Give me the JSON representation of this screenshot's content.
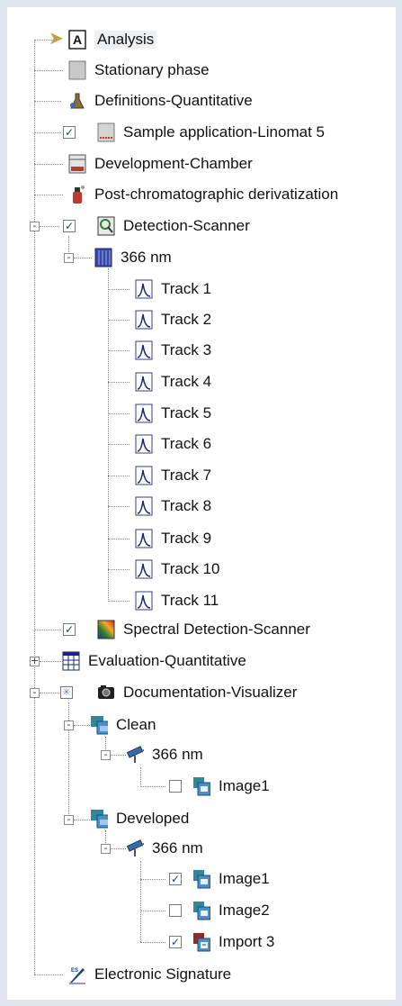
{
  "tree": {
    "analysis": "Analysis",
    "stationary_phase": "Stationary phase",
    "definitions_quantitative": "Definitions-Quantitative",
    "sample_application": "Sample application-Linomat 5",
    "development_chamber": "Development-Chamber",
    "post_chromatographic": "Post-chromatographic derivatization",
    "detection_scanner": "Detection-Scanner",
    "wavelength_366": "366 nm",
    "tracks": [
      "Track 1",
      "Track 2",
      "Track 3",
      "Track 4",
      "Track 5",
      "Track 6",
      "Track 7",
      "Track 8",
      "Track 9",
      "Track 10",
      "Track 11"
    ],
    "spectral_detection": "Spectral Detection-Scanner",
    "evaluation_quantitative": "Evaluation-Quantitative",
    "documentation_visualizer": "Documentation-Visualizer",
    "clean": "Clean",
    "clean_366": "366 nm",
    "clean_image1": "Image1",
    "developed": "Developed",
    "developed_366": "366 nm",
    "developed_image1": "Image1",
    "developed_image2": "Image2",
    "developed_import3": "Import 3",
    "electronic_signature": "Electronic Signature"
  },
  "checkboxes": {
    "sample_application": true,
    "detection_scanner": true,
    "spectral_detection": true,
    "clean_image1": false,
    "developed_image1": true,
    "developed_image2": false,
    "developed_import3": true
  },
  "expanders": {
    "detection_scanner": "-",
    "wavelength_366": "-",
    "evaluation_quantitative": "+",
    "documentation_visualizer": "-",
    "clean": "-",
    "clean_366": "-",
    "developed": "-",
    "developed_366": "-"
  },
  "icons": {
    "analysis": "analysis-icon",
    "stationary_phase": "plate-icon",
    "definitions_quantitative": "flask-icon",
    "sample_application": "sample-application-icon",
    "development_chamber": "chamber-icon",
    "post_chromatographic": "spray-bottle-icon",
    "detection_scanner": "scanner-icon",
    "wavelength_366": "wavelength-icon",
    "track": "peak-icon",
    "spectral_detection": "spectrum-icon",
    "evaluation_quantitative": "table-icon",
    "documentation_visualizer": "camera-icon",
    "clean": "images-folder-icon",
    "wavelength_lamp": "lamp-icon",
    "image": "image-icon",
    "import": "import-icon",
    "electronic_signature": "signature-icon"
  }
}
